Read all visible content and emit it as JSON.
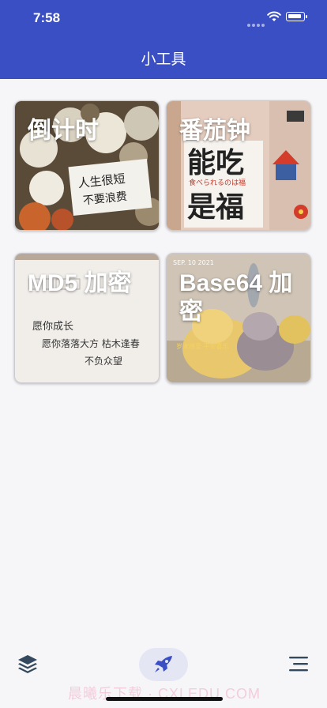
{
  "status_bar": {
    "time": "7:58"
  },
  "header": {
    "title": "小工具"
  },
  "cards": [
    {
      "label": "倒计时",
      "note_line1": "人生很短",
      "note_line2": "不要浪费"
    },
    {
      "label": "番茄钟",
      "sign_line1": "能吃",
      "sign_sub": "食べられるのは福",
      "sign_line2": "是福"
    },
    {
      "label": "MD5 加密",
      "note_line1": "愿你成长",
      "note_line2": "愿你落落大方 枯木逢春",
      "note_line3": "不负众望"
    },
    {
      "label": "Base64 加密",
      "date_stamp": "SEP. 10 2021",
      "caption": "岁末将至 平安喜乐"
    }
  ],
  "bottom_nav": {
    "watermark": "晨曦乐下载 · CXLEDU.COM"
  }
}
